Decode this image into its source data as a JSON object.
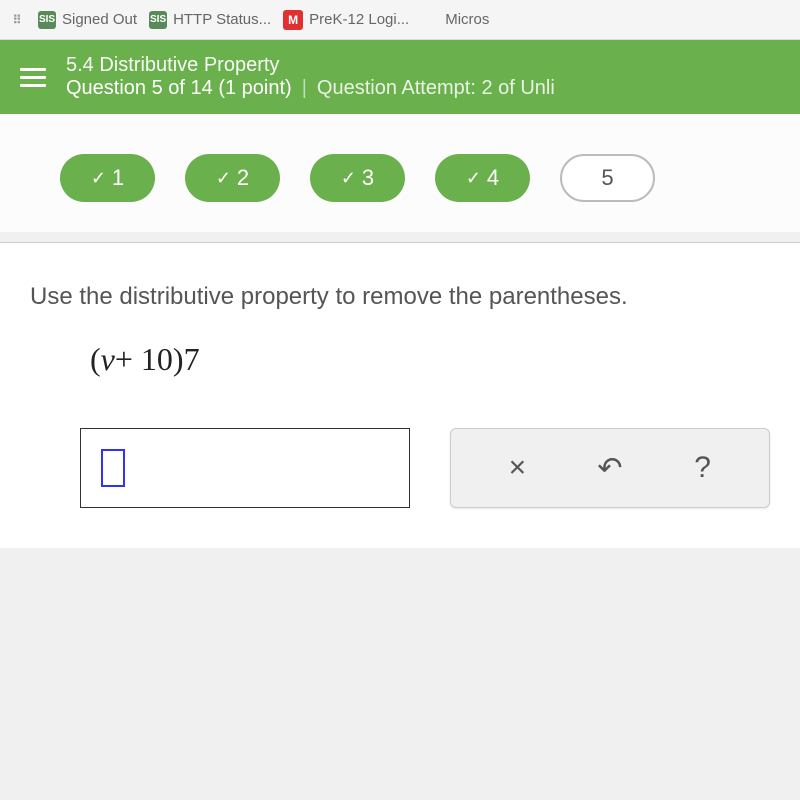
{
  "bookmarks": {
    "items": [
      {
        "icon": "dots",
        "label": ""
      },
      {
        "icon": "sis",
        "label": "Signed Out"
      },
      {
        "icon": "sis",
        "label": "HTTP Status..."
      },
      {
        "icon": "m",
        "label": "PreK-12 Logi..."
      },
      {
        "icon": "ms",
        "label": "Micros"
      }
    ]
  },
  "header": {
    "title": "5.4 Distributive Property",
    "question_label": "Question 5 of 14 (1 point)",
    "attempt_label": "Question Attempt: 2 of Unli"
  },
  "progress": {
    "items": [
      {
        "num": "1",
        "state": "done"
      },
      {
        "num": "2",
        "state": "done"
      },
      {
        "num": "3",
        "state": "done"
      },
      {
        "num": "4",
        "state": "done"
      },
      {
        "num": "5",
        "state": "current"
      }
    ]
  },
  "question": {
    "prompt": "Use the distributive property to remove the parentheses.",
    "expression_var": "v",
    "expression_plus": "+ 10)7",
    "expression_open": "("
  },
  "tools": {
    "clear": "×",
    "undo": "↶",
    "help": "?"
  }
}
